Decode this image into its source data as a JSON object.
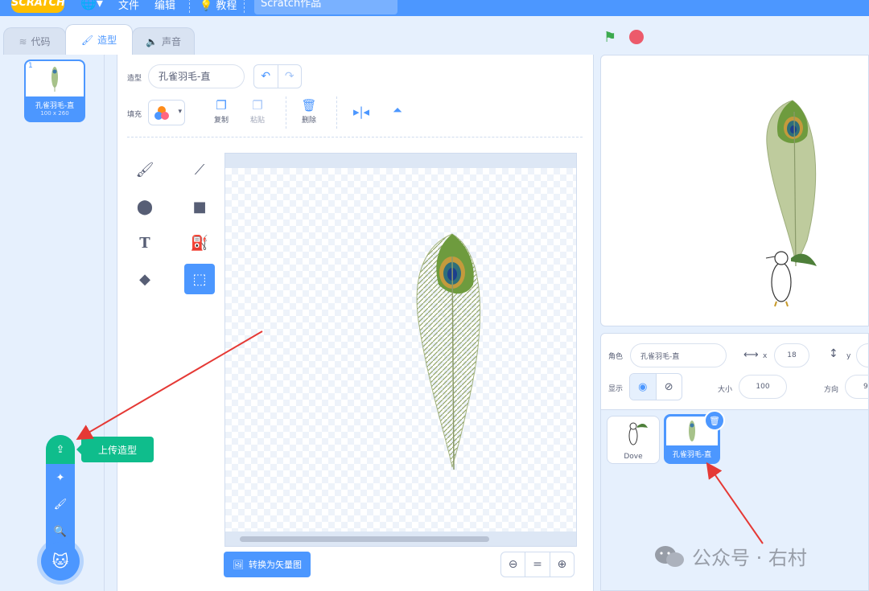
{
  "menubar": {
    "logo": "SCRATCH",
    "file": "文件",
    "edit": "编辑",
    "tutorials": "教程",
    "project_title": "Scratch作品"
  },
  "tabs": [
    {
      "label": "代码",
      "icon": "code-icon"
    },
    {
      "label": "造型",
      "icon": "brush-icon"
    },
    {
      "label": "声音",
      "icon": "speaker-icon"
    }
  ],
  "costume_list": [
    {
      "number": "1",
      "name": "孔雀羽毛-直",
      "size": "100 x 260"
    }
  ],
  "editor": {
    "costume_label": "造型",
    "costume_name": "孔雀羽毛-直",
    "fill_label": "填充",
    "actions": {
      "copy": "复制",
      "paste": "粘贴",
      "delete": "删除"
    },
    "convert_button": "转换为矢量图",
    "zoom": {
      "out": "−",
      "reset": "=",
      "in": "+"
    }
  },
  "upload_menu": {
    "tooltip": "上传造型"
  },
  "sprite_info": {
    "sprite_label": "角色",
    "sprite_name": "孔雀羽毛-直",
    "x_label": "x",
    "x_value": "18",
    "y_label": "y",
    "show_label": "显示",
    "size_label": "大小",
    "size_value": "100",
    "direction_label": "方向",
    "direction_value": "9"
  },
  "sprites": [
    {
      "name": "Dove",
      "selected": false
    },
    {
      "name": "孔雀羽毛-直",
      "selected": true
    }
  ],
  "watermark": "公众号 · 右村",
  "colors": {
    "scratch_blue": "#4c97ff",
    "upload_green": "#0fbd8c",
    "arrow_red": "#e53935"
  }
}
